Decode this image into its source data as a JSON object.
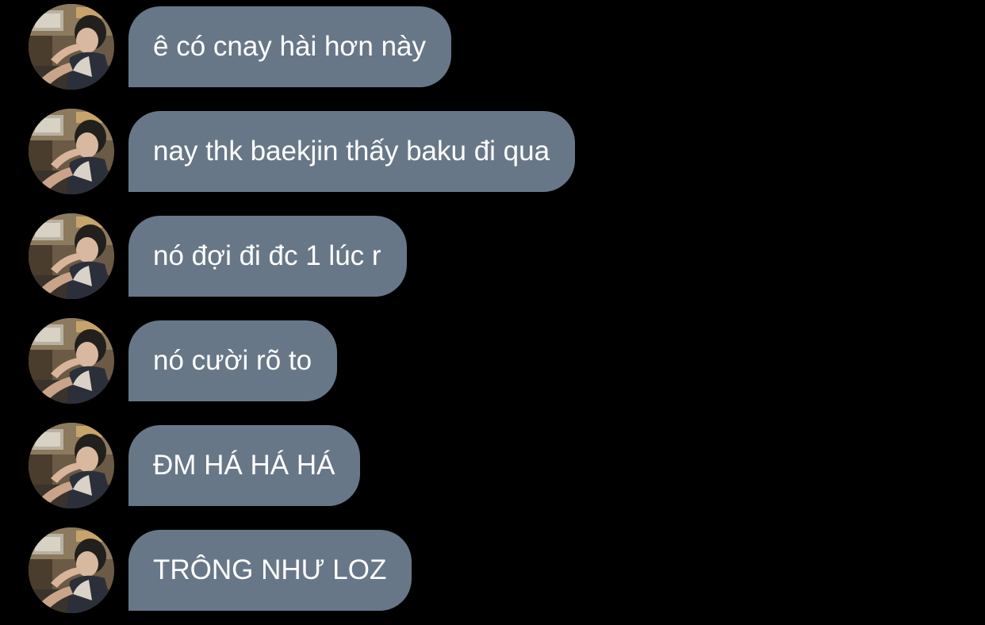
{
  "colors": {
    "background": "#000000",
    "bubble": "#687787",
    "bubble_text": "#ffffff"
  },
  "messages": [
    {
      "text": "ê có cnay hài hơn này",
      "avatar": "profile-photo"
    },
    {
      "text": "nay thk baekjin thấy baku đi qua",
      "avatar": "profile-photo"
    },
    {
      "text": "nó đợi đi đc 1 lúc r",
      "avatar": "profile-photo"
    },
    {
      "text": "nó cười rõ to",
      "avatar": "profile-photo"
    },
    {
      "text": "ĐM HÁ HÁ HÁ",
      "avatar": "profile-photo"
    },
    {
      "text": "TRÔNG NHƯ LOZ",
      "avatar": "profile-photo"
    }
  ]
}
